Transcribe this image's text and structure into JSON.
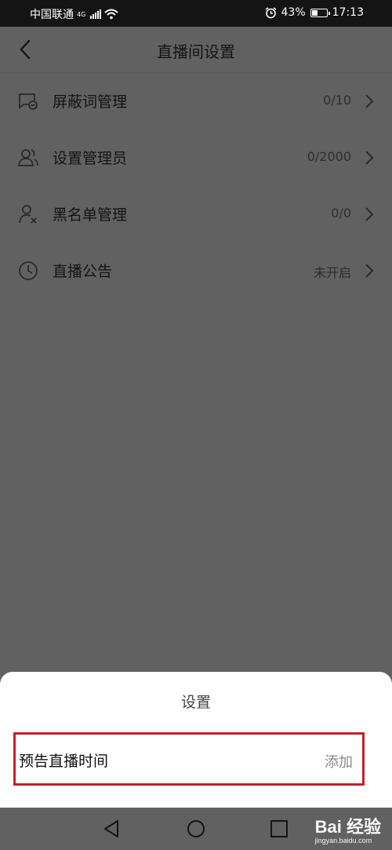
{
  "status_bar": {
    "carrier": "中国联通",
    "network": "4G",
    "battery": "43%",
    "battery_level": 0.43,
    "time": "17:13"
  },
  "header": {
    "title": "直播间设置"
  },
  "settings": [
    {
      "label": "屏蔽词管理",
      "value": "0/10",
      "icon": "blocked-words-icon"
    },
    {
      "label": "设置管理员",
      "value": "0/2000",
      "icon": "admins-icon"
    },
    {
      "label": "黑名单管理",
      "value": "0/0",
      "icon": "blacklist-icon"
    },
    {
      "label": "直播公告",
      "value": "未开启",
      "icon": "clock-icon"
    }
  ],
  "sheet": {
    "title": "设置",
    "item_label": "预告直播时间",
    "item_action": "添加"
  },
  "watermark": {
    "brand": "Bai 经验",
    "url": "jingyan.baidu.com"
  },
  "colors": {
    "overlay": "#616161",
    "highlight": "#c81e28",
    "sheet": "#ffffff"
  }
}
